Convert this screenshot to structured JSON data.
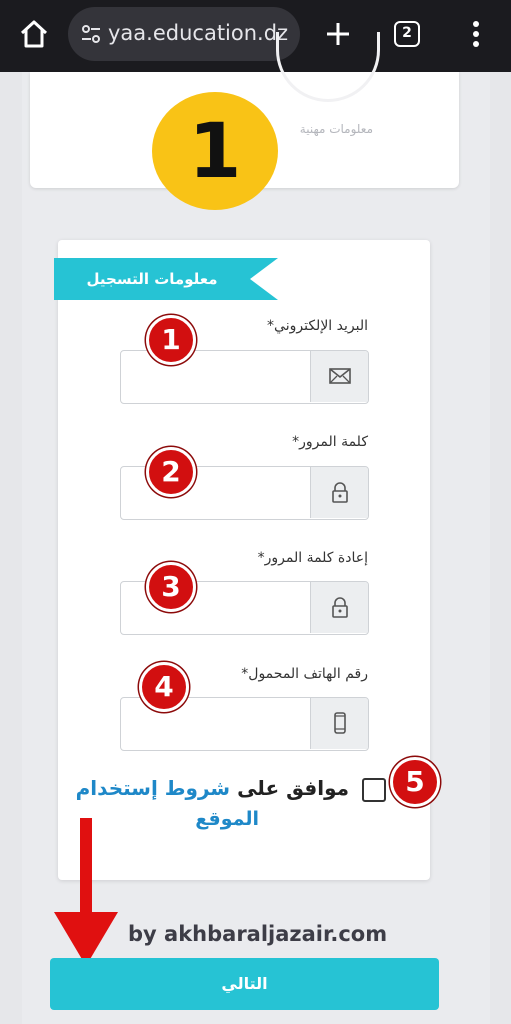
{
  "browser": {
    "url_text": "yaa.education.dz",
    "tab_count": "2"
  },
  "upper_card": {
    "label": "معلومات مهنية",
    "step_number": "1"
  },
  "form": {
    "section_title": "معلومات التسجيل",
    "fields": [
      {
        "label": "البريد الإلكتروني*",
        "icon": "envelope-icon",
        "badge": "1"
      },
      {
        "label": "كلمة المرور*",
        "icon": "lock-icon",
        "badge": "2"
      },
      {
        "label": "إعادة كلمة المرور*",
        "icon": "lock-icon",
        "badge": "3"
      },
      {
        "label": "رقم الهاتف المحمول*",
        "icon": "phone-icon",
        "badge": "4"
      }
    ],
    "terms": {
      "agree_text": "موافق على",
      "link_text_line1": "شروط إستخدام",
      "link_text_line2": "الموقع",
      "badge": "5"
    },
    "next_button": "التالي"
  },
  "watermark": "by akhbaraljazair.com",
  "colors": {
    "accent": "#26c3d4",
    "badge_red": "#d20f10",
    "step_yellow": "#f9c316",
    "link": "#1e88c8",
    "arrow_red": "#e01010"
  }
}
